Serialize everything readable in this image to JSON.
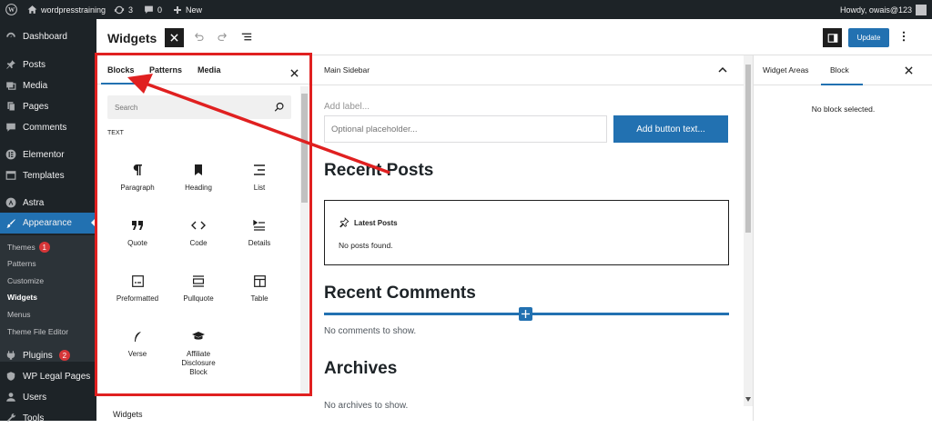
{
  "adminbar": {
    "site_name": "wordpresstraining",
    "updates_count": "3",
    "comments_count": "0",
    "new_label": "New",
    "howdy": "Howdy, owais@123"
  },
  "sidebar": {
    "items": [
      {
        "label": "Dashboard",
        "icon": "dashboard-icon"
      },
      {
        "label": "Posts",
        "icon": "pin-icon"
      },
      {
        "label": "Media",
        "icon": "media-icon"
      },
      {
        "label": "Pages",
        "icon": "pages-icon"
      },
      {
        "label": "Comments",
        "icon": "comments-icon"
      },
      {
        "label": "Elementor",
        "icon": "elementor-icon"
      },
      {
        "label": "Templates",
        "icon": "templates-icon"
      },
      {
        "label": "Astra",
        "icon": "astra-icon"
      },
      {
        "label": "Appearance",
        "icon": "brush-icon"
      },
      {
        "label": "Plugins",
        "icon": "plugins-icon",
        "badge": "2"
      },
      {
        "label": "WP Legal Pages",
        "icon": "legal-icon"
      },
      {
        "label": "Users",
        "icon": "users-icon"
      },
      {
        "label": "Tools",
        "icon": "tools-icon"
      }
    ],
    "submenu": [
      {
        "label": "Themes",
        "badge": "1"
      },
      {
        "label": "Patterns"
      },
      {
        "label": "Customize"
      },
      {
        "label": "Widgets"
      },
      {
        "label": "Menus"
      },
      {
        "label": "Theme File Editor"
      }
    ]
  },
  "header": {
    "title": "Widgets",
    "update_label": "Update"
  },
  "inserter": {
    "tabs": [
      "Blocks",
      "Patterns",
      "Media"
    ],
    "search_placeholder": "Search",
    "section_label": "TEXT",
    "blocks": [
      {
        "label": "Paragraph",
        "icon": "paragraph-icon"
      },
      {
        "label": "Heading",
        "icon": "heading-icon"
      },
      {
        "label": "List",
        "icon": "list-icon"
      },
      {
        "label": "Quote",
        "icon": "quote-icon"
      },
      {
        "label": "Code",
        "icon": "code-icon"
      },
      {
        "label": "Details",
        "icon": "details-icon"
      },
      {
        "label": "Preformatted",
        "icon": "preformatted-icon"
      },
      {
        "label": "Pullquote",
        "icon": "pullquote-icon"
      },
      {
        "label": "Table",
        "icon": "table-icon"
      },
      {
        "label": "Verse",
        "icon": "verse-icon"
      },
      {
        "label": "Affiliate Disclosure Block",
        "icon": "graduation-cap-icon"
      }
    ]
  },
  "canvas": {
    "area_title": "Main Sidebar",
    "add_label_placeholder": "Add label...",
    "input_placeholder": "Optional placeholder...",
    "button_text": "Add button text...",
    "recent_posts_heading": "Recent Posts",
    "latest_posts_label": "Latest Posts",
    "no_posts": "No posts found.",
    "recent_comments_heading": "Recent Comments",
    "no_comments": "No comments to show.",
    "archives_heading": "Archives",
    "no_archives": "No archives to show."
  },
  "settings": {
    "tabs": [
      "Widget Areas",
      "Block"
    ],
    "empty_message": "No block selected."
  },
  "footer": {
    "breadcrumb": "Widgets"
  },
  "colors": {
    "accent": "#2271b1",
    "annotation": "#e02020",
    "admin_dark": "#1d2327"
  }
}
